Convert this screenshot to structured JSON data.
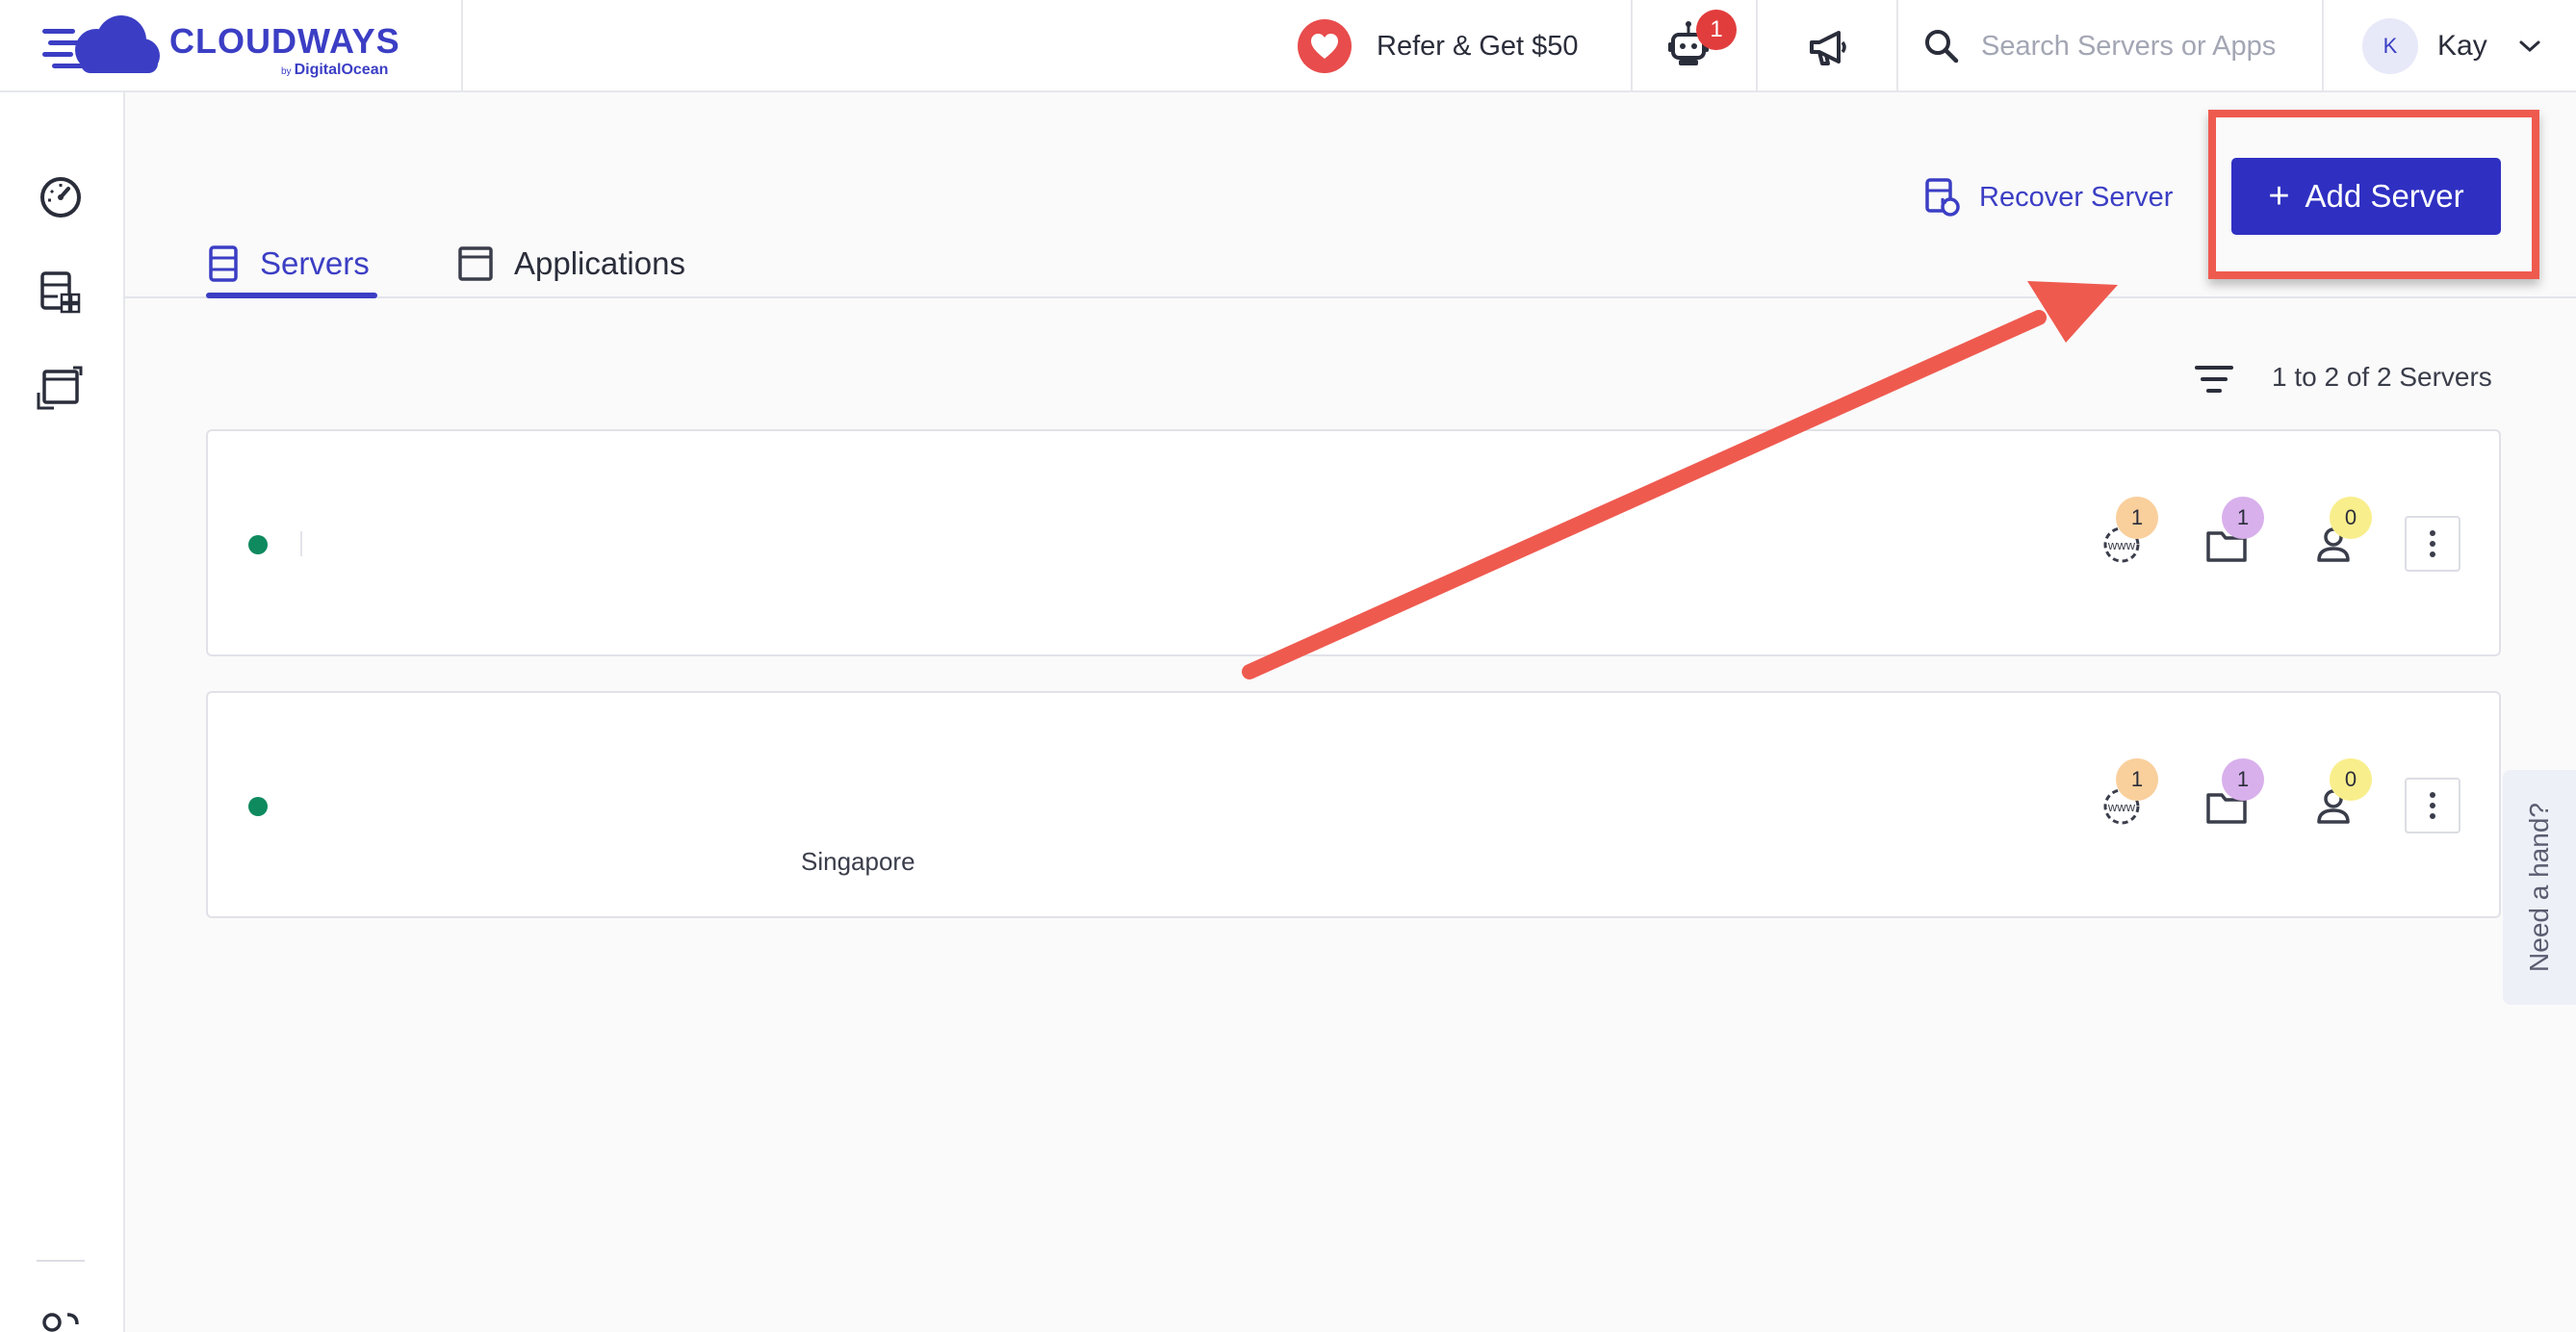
{
  "brand": {
    "name": "CLOUDWAYS",
    "by": "by",
    "sub": "DigitalOcean"
  },
  "header": {
    "refer_label": "Refer & Get $50",
    "bot_badge": "1",
    "search_placeholder": "Search Servers or Apps",
    "user_initial": "K",
    "user_name": "Kay"
  },
  "tabs": [
    {
      "label": "Servers",
      "active": true
    },
    {
      "label": "Applications",
      "active": false
    }
  ],
  "actions": {
    "recover_label": "Recover Server",
    "add_label": "Add Server",
    "add_icon": "+"
  },
  "list": {
    "count_text": "1 to 2 of 2 Servers"
  },
  "servers": [
    {
      "status": "running",
      "location": "",
      "sites": "1",
      "folders": "1",
      "users": "0"
    },
    {
      "status": "running",
      "location": "Singapore",
      "sites": "1",
      "folders": "1",
      "users": "0"
    }
  ],
  "help_label": "Need a hand?",
  "colors": {
    "accent": "#3b3ec4",
    "button": "#2f30c2",
    "annotation": "#ef5a4f",
    "status_running": "#0f8a5f"
  }
}
